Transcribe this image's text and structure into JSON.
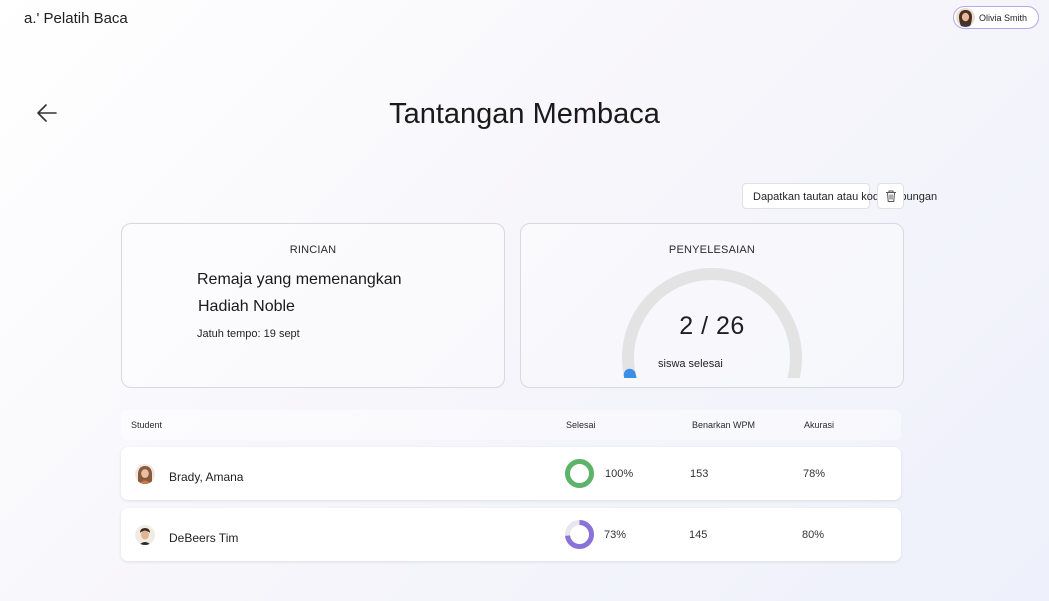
{
  "app": {
    "name": "a.' Pelatih Baca"
  },
  "user": {
    "name": "Olivia Smith"
  },
  "page": {
    "title": "Tantangan Membaca"
  },
  "toolbar": {
    "link_label": "Dapatkan tautan atau kode gabungan",
    "delete_icon": "trash-icon"
  },
  "details": {
    "header": "RINCIAN",
    "book_line1": "Remaja yang memenangkan",
    "book_line2": "Hadiah Noble",
    "due": "Jatuh tempo: 19 sept"
  },
  "completion": {
    "header": "PENYELESAIAN",
    "value_text": "2 / 26",
    "completed": 2,
    "total": 26,
    "caption": "siswa selesai"
  },
  "table": {
    "headers": {
      "student": "Student",
      "done": "Selesai",
      "wpm": "Benarkan WPM",
      "accuracy": "Akurasi"
    },
    "rows": [
      {
        "name": "Brady, Amana",
        "done": "100%",
        "done_fraction": 1.0,
        "ring_color": "#5cb36a",
        "wpm": "153",
        "accuracy": "78%"
      },
      {
        "name": "DeBeers Tim",
        "done": "73%",
        "done_fraction": 0.73,
        "ring_color": "#8a72d8",
        "wpm": "145",
        "accuracy": "80%"
      }
    ]
  },
  "colors": {
    "accent_blue": "#3c8fe6",
    "gauge_track": "#e3e3e3",
    "chip_border": "#b9a6e8"
  }
}
